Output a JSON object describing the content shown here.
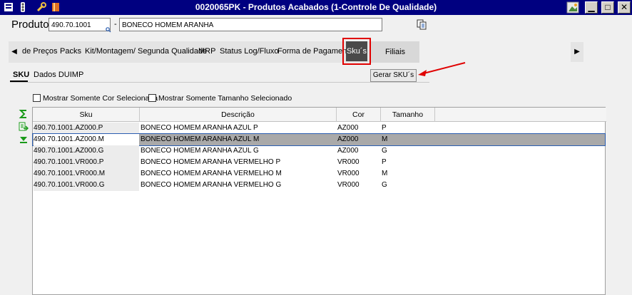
{
  "window": {
    "title": "0020065PK - Produtos Acabados (1-Controle De Qualidade)"
  },
  "produto": {
    "label": "Produto",
    "code": "490.70.1001",
    "separator": "-",
    "description": "BONECO HOMEM ARANHA"
  },
  "tabs": {
    "items": [
      {
        "label": "de Preços"
      },
      {
        "label": "Packs"
      },
      {
        "label": "Kit/Montagem/ Segunda Qualidade"
      },
      {
        "label": "MRP"
      },
      {
        "label": "Status Log/Fluxo"
      },
      {
        "label": "Forma de Pagamento"
      }
    ],
    "active": "Sku´s",
    "filiais": "Filiais"
  },
  "subtabs": {
    "sku": "SKU",
    "duimp": "Dados DUIMP"
  },
  "gerar_button": "Gerar SKU´s",
  "checkboxes": {
    "cor": "Mostrar Somente Cor Selecionada",
    "tamanho": "Mostrar Somente Tamanho Selecionado"
  },
  "grid": {
    "headers": {
      "sku": "Sku",
      "descricao": "Descrição",
      "cor": "Cor",
      "tamanho": "Tamanho"
    },
    "rows": [
      {
        "sku": "490.70.1001.AZ000.P",
        "descricao": "BONECO HOMEM ARANHA AZUL P",
        "cor": "AZ000",
        "tamanho": "P"
      },
      {
        "sku": "490.70.1001.AZ000.M",
        "descricao": "BONECO HOMEM ARANHA AZUL M",
        "cor": "AZ000",
        "tamanho": "M"
      },
      {
        "sku": "490.70.1001.AZ000.G",
        "descricao": "BONECO HOMEM ARANHA AZUL G",
        "cor": "AZ000",
        "tamanho": "G"
      },
      {
        "sku": "490.70.1001.VR000.P",
        "descricao": "BONECO HOMEM ARANHA VERMELHO P",
        "cor": "VR000",
        "tamanho": "P"
      },
      {
        "sku": "490.70.1001.VR000.M",
        "descricao": "BONECO HOMEM ARANHA VERMELHO M",
        "cor": "VR000",
        "tamanho": "M"
      },
      {
        "sku": "490.70.1001.VR000.G",
        "descricao": "BONECO HOMEM ARANHA VERMELHO G",
        "cor": "VR000",
        "tamanho": "G"
      }
    ]
  },
  "colors": {
    "titlebar": "#000080",
    "highlight": "#e00000",
    "selected_row": "#a9a9a9"
  }
}
